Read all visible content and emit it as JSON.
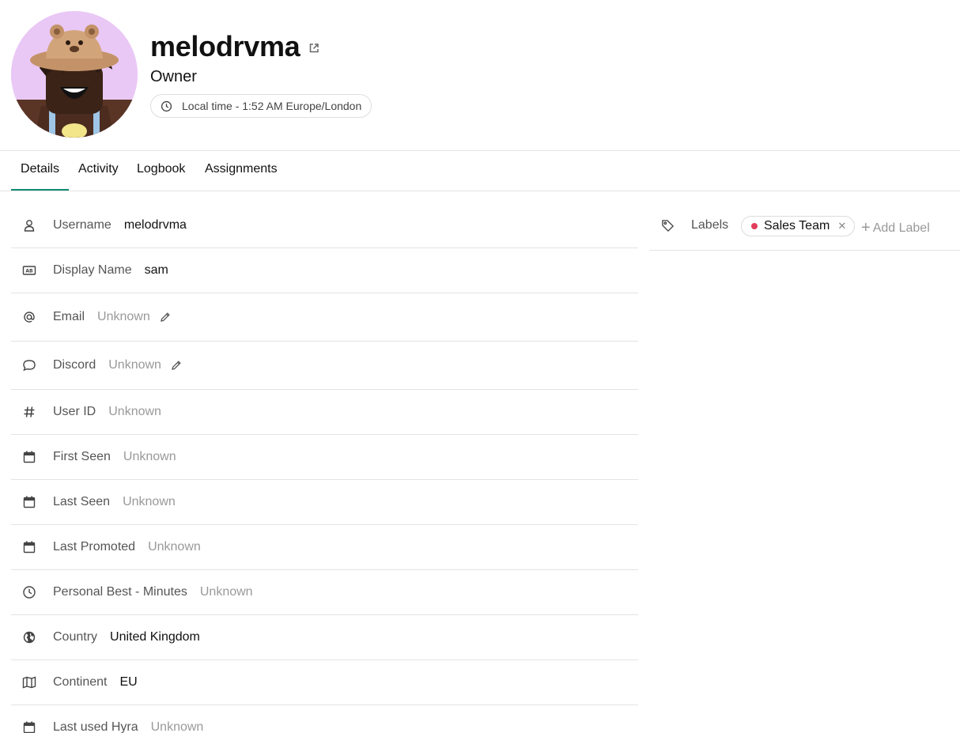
{
  "profile": {
    "username": "melodrvma",
    "role": "Owner",
    "local_time": "Local time - 1:52 AM Europe/London"
  },
  "tabs": [
    {
      "label": "Details",
      "active": true
    },
    {
      "label": "Activity",
      "active": false
    },
    {
      "label": "Logbook",
      "active": false
    },
    {
      "label": "Assignments",
      "active": false
    }
  ],
  "details": [
    {
      "label": "Username",
      "value": "melodrvma",
      "muted": false,
      "icon": "user-icon"
    },
    {
      "label": "Display Name",
      "value": "sam",
      "muted": false,
      "icon": "id-card-icon"
    },
    {
      "label": "Email",
      "value": "Unknown",
      "muted": true,
      "icon": "at-icon",
      "editable": true
    },
    {
      "label": "Discord",
      "value": "Unknown",
      "muted": true,
      "icon": "chat-bubble-icon",
      "editable": true
    },
    {
      "label": "User ID",
      "value": "Unknown",
      "muted": true,
      "icon": "hash-icon"
    },
    {
      "label": "First Seen",
      "value": "Unknown",
      "muted": true,
      "icon": "calendar-icon"
    },
    {
      "label": "Last Seen",
      "value": "Unknown",
      "muted": true,
      "icon": "calendar-icon"
    },
    {
      "label": "Last Promoted",
      "value": "Unknown",
      "muted": true,
      "icon": "calendar-icon"
    },
    {
      "label": "Personal Best - Minutes",
      "value": "Unknown",
      "muted": true,
      "icon": "clock-icon"
    },
    {
      "label": "Country",
      "value": "United Kingdom",
      "muted": false,
      "icon": "globe-icon"
    },
    {
      "label": "Continent",
      "value": "EU",
      "muted": false,
      "icon": "map-icon"
    },
    {
      "label": "Last used Hyra",
      "value": "Unknown",
      "muted": true,
      "icon": "calendar-icon"
    }
  ],
  "labels": {
    "title": "Labels",
    "chips": [
      {
        "text": "Sales Team",
        "color": "#e23c5a"
      }
    ],
    "add_label": "Add Label"
  },
  "colors": {
    "accent": "#0f8a73",
    "avatar_bg": "#e9c8f5",
    "label_dot": "#e23c5a"
  }
}
